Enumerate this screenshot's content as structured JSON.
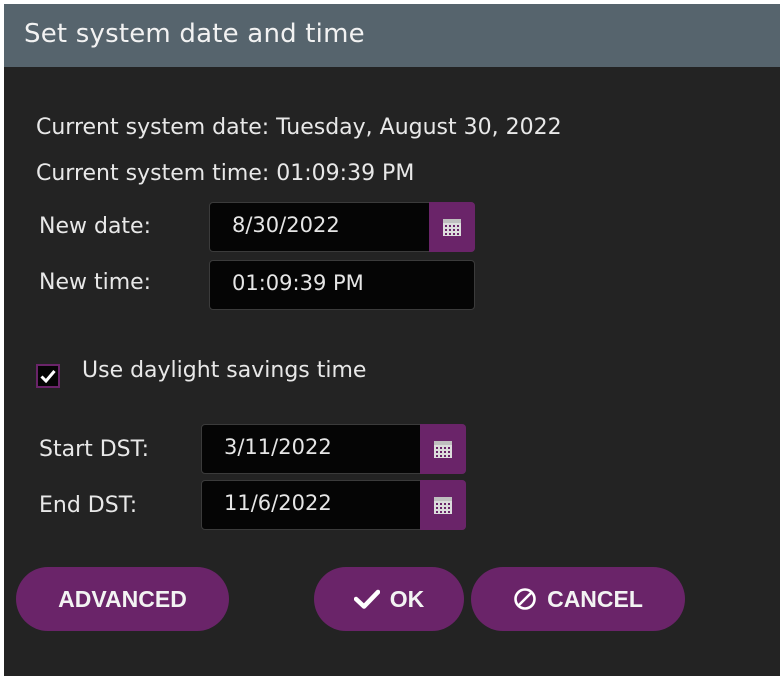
{
  "dialog": {
    "title": "Set system date and time",
    "current_date": "Current system date: Tuesday, August 30, 2022",
    "current_time": "Current system time: 01:09:39 PM",
    "new_date_label": "New date:",
    "new_date_value": "8/30/2022",
    "new_time_label": "New time:",
    "new_time_value": "01:09:39 PM",
    "dst_checkbox_label": "Use daylight savings time",
    "dst_checked": true,
    "start_dst_label": "Start DST:",
    "start_dst_value": "3/11/2022",
    "end_dst_label": "End DST:",
    "end_dst_value": "11/6/2022"
  },
  "buttons": {
    "advanced": "ADVANCED",
    "ok": "OK",
    "cancel": "CANCEL"
  },
  "icons": {
    "calendar": "calendar-icon",
    "check": "check-icon",
    "cancel": "cancel-circle-icon"
  },
  "colors": {
    "accent": "#6a2469",
    "background": "#232323",
    "titlebar": "#56646d",
    "field": "#050505"
  }
}
